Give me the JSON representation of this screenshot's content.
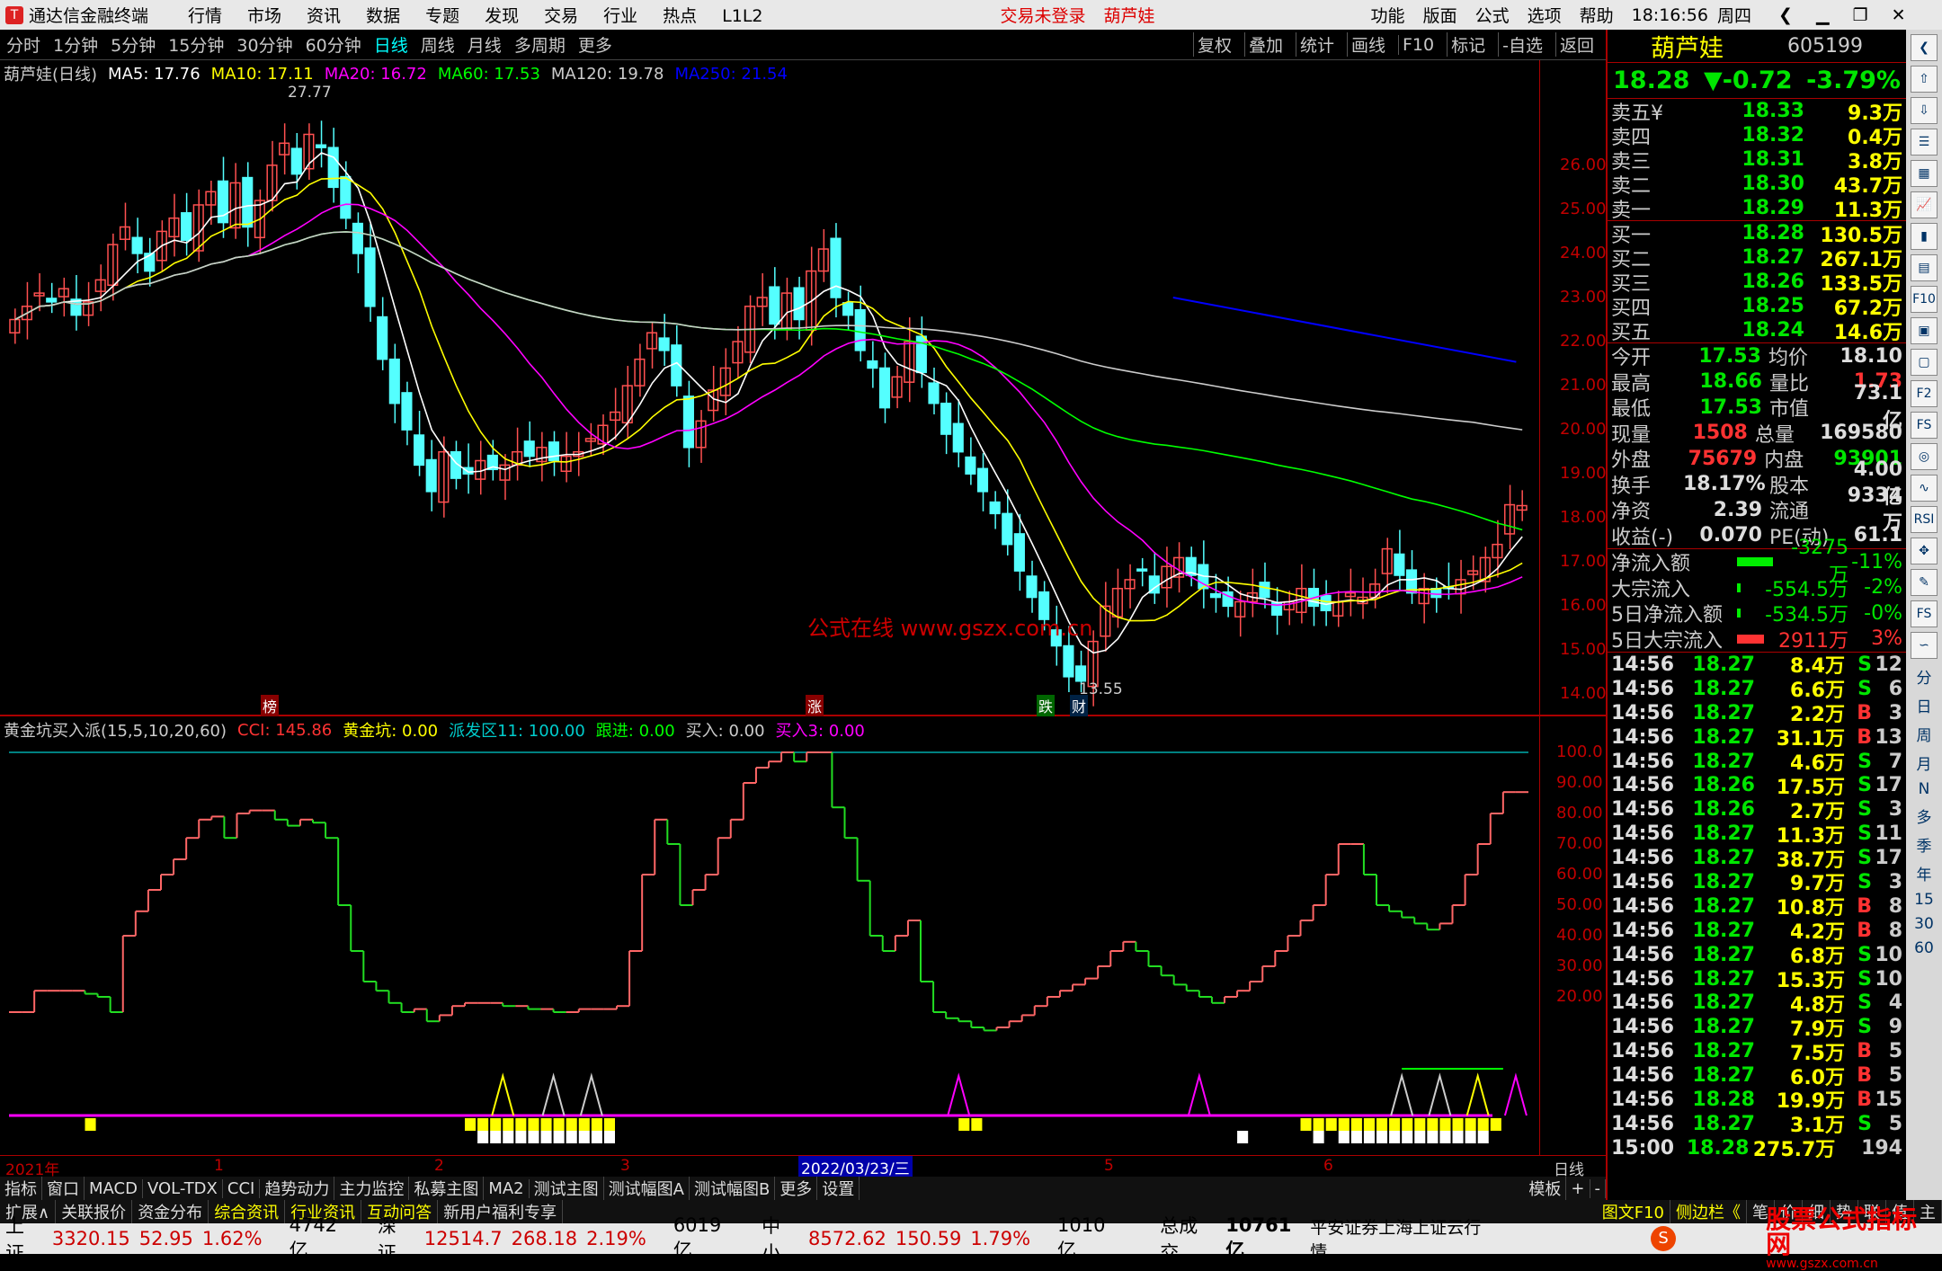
{
  "app": {
    "title": "通达信金融终端",
    "menu": [
      "行情",
      "市场",
      "资讯",
      "数据",
      "专题",
      "发现",
      "交易",
      "行业",
      "热点",
      "L1L2"
    ],
    "trade_status": "交易未登录",
    "stock_name_title": "葫芦娃",
    "right_menu": [
      "功能",
      "版面",
      "公式",
      "选项",
      "帮助"
    ],
    "time": "18:16:56",
    "weekday": "周四"
  },
  "periods": [
    "分时",
    "1分钟",
    "5分钟",
    "15分钟",
    "30分钟",
    "60分钟",
    "日线",
    "周线",
    "月线",
    "多周期",
    "更多"
  ],
  "chart_buttons": [
    "复权",
    "叠加",
    "统计",
    "画线",
    "F10",
    "标记",
    "-自选",
    "返回"
  ],
  "main_legend": {
    "name": "葫芦娃(日线)",
    "ma5": "MA5: 17.76",
    "ma10": "MA10: 17.11",
    "ma20": "MA20: 16.72",
    "ma60": "MA60: 17.53",
    "ma120": "MA120: 19.78",
    "ma250": "MA250: 21.54"
  },
  "annotations": {
    "high": "27.77",
    "low": "13.55",
    "watermark": "公式在线  www.gszx.com.cn",
    "tag1": "榜",
    "tag2": "涨",
    "tag3": "跌",
    "tag4": "财"
  },
  "price_axis": [
    "26.00",
    "25.00",
    "24.00",
    "23.00",
    "22.00",
    "21.00",
    "20.00",
    "19.00",
    "18.00",
    "17.00",
    "16.00",
    "15.00",
    "14.00"
  ],
  "ind_legend": {
    "name": "黄金坑买入派(15,5,10,20,60)",
    "cci": "CCI: 145.86",
    "hjk": "黄金坑: 0.00",
    "pfq": "派发区11: 100.00",
    "gj": "跟进: 0.00",
    "mr": "买入: 0.00",
    "mr3": "买入3: 0.00"
  },
  "ind_axis": [
    "100.0",
    "90.00",
    "80.00",
    "70.00",
    "60.00",
    "50.00",
    "40.00",
    "30.00",
    "20.00"
  ],
  "dates": {
    "y2021": "2021年",
    "m1": "1",
    "m2": "2",
    "m3": "3",
    "cursor": "2022/03/23/三",
    "m5": "5",
    "m6": "6",
    "label": "日线"
  },
  "tabs1": [
    "指标",
    "窗口",
    "MACD",
    "VOL-TDX",
    "CCI",
    "趋势动力",
    "主力监控",
    "私募主图",
    "MA2",
    "测试主图",
    "测试幅图A",
    "测试幅图B",
    "更多",
    "设置"
  ],
  "tabs1_right": [
    "模板",
    "+",
    "-"
  ],
  "tabs2": [
    "扩展∧",
    "关联报价",
    "资金分布",
    "综合资讯",
    "行业资讯",
    "互动问答",
    "新用户福利专享"
  ],
  "tabs2_right": [
    "图文F10",
    "侧边栏《",
    "笔",
    "价",
    "细",
    "势",
    "联",
    "值",
    "主"
  ],
  "status": [
    {
      "name": "上证",
      "price": "3320.15",
      "chg": "52.95",
      "pct": "1.62%",
      "amt": "4742亿"
    },
    {
      "name": "深证",
      "price": "12514.7",
      "chg": "268.18",
      "pct": "2.19%",
      "amt": "6019亿"
    },
    {
      "name": "中小",
      "price": "8572.62",
      "chg": "150.59",
      "pct": "1.79%",
      "amt": "1010亿"
    }
  ],
  "status_total": "总成交",
  "status_total_val": "10761亿",
  "status_info": "平安证券上海上证云行情",
  "brand": "股票公式指标网",
  "brand_url": "www.gszx.com.cn",
  "quote": {
    "name": "葫芦娃",
    "code": "605199",
    "price": "18.28",
    "chg": "▼-0.72",
    "pct": "-3.79%",
    "asks": [
      [
        "卖五¥",
        "18.33",
        "9.3万"
      ],
      [
        "卖四",
        "18.32",
        "0.4万"
      ],
      [
        "卖三",
        "18.31",
        "3.8万"
      ],
      [
        "卖二",
        "18.30",
        "43.7万"
      ],
      [
        "卖一",
        "18.29",
        "11.3万"
      ]
    ],
    "bids": [
      [
        "买一",
        "18.28",
        "130.5万"
      ],
      [
        "买二",
        "18.27",
        "267.1万"
      ],
      [
        "买三",
        "18.26",
        "133.5万"
      ],
      [
        "买四",
        "18.25",
        "67.2万"
      ],
      [
        "买五",
        "18.24",
        "14.6万"
      ]
    ],
    "stats": [
      [
        "今开",
        "17.53",
        "均价",
        "18.10"
      ],
      [
        "最高",
        "18.66",
        "量比",
        "1.73"
      ],
      [
        "最低",
        "17.53",
        "市值",
        "73.1亿"
      ],
      [
        "现量",
        "1508",
        "总量",
        "169580"
      ],
      [
        "外盘",
        "75679",
        "内盘",
        "93901"
      ],
      [
        "换手",
        "18.17%",
        "股本",
        "4.00亿"
      ],
      [
        "净资",
        "2.39",
        "流通",
        "9334万"
      ],
      [
        "收益(-)",
        "0.070",
        "PE(动)",
        "61.1"
      ]
    ],
    "flows": [
      [
        "净流入额",
        "-3275万",
        "-11%"
      ],
      [
        "大宗流入",
        "-554.5万",
        "-2%"
      ],
      [
        "5日净流入额",
        "-534.5万",
        "-0%"
      ],
      [
        "5日大宗流入",
        "2911万",
        "3%"
      ]
    ],
    "ticks": [
      [
        "14:56",
        "18.27",
        "8.4万",
        "S",
        "12"
      ],
      [
        "14:56",
        "18.27",
        "6.6万",
        "S",
        "6"
      ],
      [
        "14:56",
        "18.27",
        "2.2万",
        "B",
        "3"
      ],
      [
        "14:56",
        "18.27",
        "31.1万",
        "B",
        "13"
      ],
      [
        "14:56",
        "18.27",
        "4.6万",
        "S",
        "7"
      ],
      [
        "14:56",
        "18.26",
        "17.5万",
        "S",
        "17"
      ],
      [
        "14:56",
        "18.26",
        "2.7万",
        "S",
        "3"
      ],
      [
        "14:56",
        "18.27",
        "11.3万",
        "S",
        "11"
      ],
      [
        "14:56",
        "18.27",
        "38.7万",
        "S",
        "17"
      ],
      [
        "14:56",
        "18.27",
        "9.7万",
        "S",
        "3"
      ],
      [
        "14:56",
        "18.27",
        "10.8万",
        "B",
        "8"
      ],
      [
        "14:56",
        "18.27",
        "4.2万",
        "B",
        "8"
      ],
      [
        "14:56",
        "18.27",
        "6.8万",
        "S",
        "10"
      ],
      [
        "14:56",
        "18.27",
        "15.3万",
        "S",
        "10"
      ],
      [
        "14:56",
        "18.27",
        "4.8万",
        "S",
        "4"
      ],
      [
        "14:56",
        "18.27",
        "7.9万",
        "S",
        "9"
      ],
      [
        "14:56",
        "18.27",
        "7.5万",
        "B",
        "5"
      ],
      [
        "14:56",
        "18.27",
        "6.0万",
        "B",
        "5"
      ],
      [
        "14:56",
        "18.28",
        "19.9万",
        "B",
        "15"
      ],
      [
        "14:56",
        "18.27",
        "3.1万",
        "S",
        "5"
      ],
      [
        "15:00",
        "18.28",
        "275.7万",
        "",
        "194"
      ]
    ]
  },
  "tools": [
    "分",
    "日",
    "周",
    "月",
    "N",
    "多",
    "季",
    "年",
    "15",
    "30",
    "60",
    "RSI"
  ],
  "chart_data": {
    "type": "candlestick",
    "ylim": [
      13.5,
      27.77
    ],
    "high": 27.77,
    "low": 13.55,
    "ma_last": {
      "MA5": 17.76,
      "MA10": 17.11,
      "MA20": 16.72,
      "MA60": 17.53,
      "MA120": 19.78,
      "MA250": 21.54
    },
    "closes": [
      22.5,
      22.8,
      23.1,
      22.9,
      23.2,
      22.6,
      22.9,
      23.4,
      24.2,
      24.6,
      24.0,
      23.6,
      24.5,
      24.8,
      24.3,
      25.1,
      25.4,
      24.7,
      25.6,
      24.6,
      25.2,
      26.0,
      26.5,
      25.8,
      26.7,
      26.4,
      25.5,
      24.8,
      24.0,
      22.8,
      21.6,
      20.6,
      20.0,
      19.2,
      18.6,
      19.5,
      18.9,
      19.0,
      19.3,
      19.1,
      19.2,
      19.5,
      19.4,
      19.6,
      19.3,
      19.4,
      19.5,
      19.8,
      20.1,
      20.4,
      21.0,
      21.6,
      22.2,
      21.8,
      21.0,
      19.6,
      20.2,
      20.9,
      21.4,
      22.0,
      22.8,
      23.0,
      22.4,
      23.1,
      22.5,
      23.6,
      24.1,
      23.0,
      22.6,
      21.8,
      21.4,
      20.5,
      21.2,
      22.0,
      21.3,
      20.6,
      19.9,
      19.5,
      19.0,
      18.6,
      18.1,
      17.4,
      16.8,
      16.2,
      15.7,
      15.1,
      14.4,
      14.3,
      15.2,
      16.0,
      16.4,
      16.6,
      16.8,
      16.3,
      16.9,
      17.1,
      16.7,
      16.4,
      16.2,
      16.0,
      16.1,
      16.3,
      16.2,
      15.8,
      16.1,
      16.4,
      16.0,
      15.9,
      16.1,
      16.3,
      16.2,
      16.5,
      17.3,
      16.7,
      16.3,
      16.4,
      16.2,
      16.4,
      16.6,
      16.8,
      17.1,
      17.4,
      18.3,
      18.28
    ],
    "indicator": {
      "name": "黄金坑买入派",
      "cci": 145.86,
      "ylim": [
        0,
        100
      ],
      "values": [
        15,
        15,
        22,
        22,
        22,
        22,
        21,
        20,
        15,
        40,
        48,
        55,
        60,
        65,
        72,
        78,
        79,
        72,
        80,
        81,
        81,
        78,
        76,
        78,
        77,
        72,
        50,
        35,
        25,
        22,
        18,
        15,
        16,
        12,
        14,
        17,
        18,
        18,
        18,
        17,
        17,
        16,
        16,
        15,
        15,
        16,
        16,
        16,
        17,
        35,
        60,
        78,
        70,
        50,
        55,
        60,
        72,
        78,
        90,
        95,
        97,
        100,
        97,
        100,
        100,
        82,
        72,
        58,
        40,
        35,
        40,
        45,
        25,
        15,
        13,
        12,
        10,
        9,
        10,
        12,
        14,
        17,
        20,
        22,
        24,
        26,
        30,
        35,
        38,
        35,
        30,
        27,
        24,
        22,
        20,
        18,
        20,
        22,
        25,
        30,
        35,
        40,
        45,
        50,
        60,
        70,
        70,
        60,
        50,
        48,
        46,
        44,
        42,
        44,
        50,
        60,
        70,
        80,
        87,
        87
      ]
    }
  }
}
